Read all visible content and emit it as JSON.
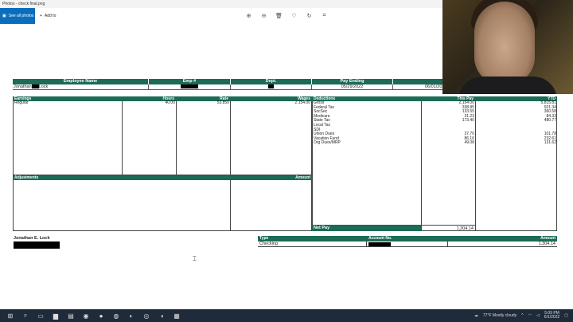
{
  "window": {
    "title": "Photos - check final.png",
    "controls": [
      "–",
      "□",
      "✕"
    ]
  },
  "toolbar": {
    "see_all_photos": "See all photos",
    "add_to": "Add to",
    "icons": [
      "zoom-in-icon",
      "zoom-out-icon",
      "delete-icon",
      "heart-icon",
      "rotate-icon",
      "crop-icon"
    ]
  },
  "paystub": {
    "header": {
      "labels": [
        "Employee Name",
        "Emp #",
        "Dept.",
        "Pay Ending",
        "Pay Date"
      ],
      "employee_name_first": "Jonathan",
      "employee_name_last": "Lock",
      "pay_ending": "05/29/2022",
      "pay_date": "06/01/2022"
    },
    "earnings": {
      "headers": [
        "Earnings",
        "Hours",
        "Rate",
        "Wages"
      ],
      "rows": [
        {
          "name": "Regular",
          "hours": "40.00",
          "rate": "53.850",
          "wages": "2,154.00"
        }
      ]
    },
    "adjustments": {
      "headers": [
        "Adjustments",
        "Amount"
      ]
    },
    "deductions": {
      "headers": [
        "Deductions",
        "This Pay",
        "YTD"
      ],
      "rows": [
        {
          "name": "Gross",
          "this_pay": "2,154.00",
          "ytd": "5,815.81"
        },
        {
          "name": "Federal Tax",
          "this_pay": "338.85",
          "ytd": "921.34"
        },
        {
          "name": "SocSec",
          "this_pay": "133.55",
          "ytd": "360.58"
        },
        {
          "name": "Medicare",
          "this_pay": "31.23",
          "ytd": "84.33"
        },
        {
          "name": "State Tax",
          "this_pay": "173.40",
          "ytd": "480.77"
        },
        {
          "name": "Local Tax",
          "this_pay": "",
          "ytd": ""
        },
        {
          "name": "SDI",
          "this_pay": "",
          "ytd": ""
        },
        {
          "name": "Union Dues",
          "this_pay": "37.70",
          "ytd": "101.78"
        },
        {
          "name": "Vacation Fund",
          "this_pay": "86.16",
          "ytd": "232.61"
        },
        {
          "name": "Org Dues/MRP",
          "this_pay": "49.08",
          "ytd": "131.62"
        }
      ]
    },
    "net_pay": {
      "label": "Net Pay",
      "value": "1,304.14"
    },
    "employee_footer_name": "Jonathan E. Lock",
    "deposit": {
      "headers": [
        "Type",
        "Account No.",
        "Amount"
      ],
      "row": {
        "type": "Checking",
        "amount": "1,304.14"
      }
    }
  },
  "taskbar": {
    "weather": "77°F  Mostly cloudy",
    "time": "5:09 PM",
    "date": "6/1/2022",
    "colors": {
      "bg": "#1f2b3a",
      "accent": "#0a6ebd",
      "table_green": "#1b6b57"
    }
  }
}
